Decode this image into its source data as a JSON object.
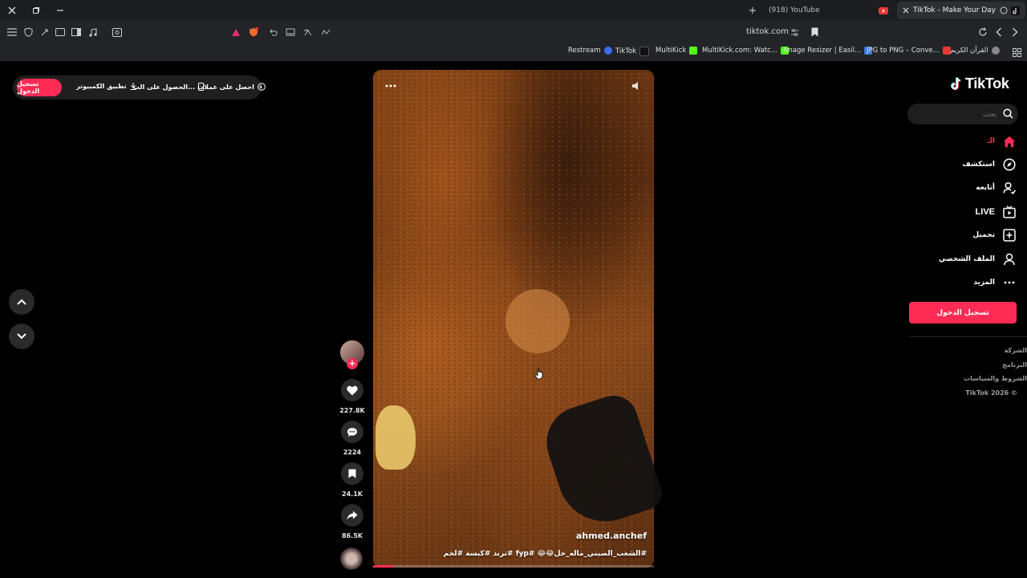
{
  "browser": {
    "tabs": [
      {
        "label": "(918) YouTube",
        "active": false
      },
      {
        "label": "TikTok - Make Your Day",
        "active": true
      }
    ],
    "url": "tiktok.com",
    "bookmarks": [
      {
        "label": "Restream",
        "color": "#3b6cf0"
      },
      {
        "label": "TikTok",
        "color": "#111111"
      },
      {
        "label": "MultiKick",
        "color": "#53fc18"
      },
      {
        "label": "MultiKick.com: Watc...",
        "color": "#53fc18"
      },
      {
        "label": "Image Resizer | Easil...",
        "color": "#3a7bd5"
      },
      {
        "label": "JPG to PNG – Conve...",
        "color": "#e53935"
      },
      {
        "label": "القرآن الكريم",
        "color": "#888888"
      }
    ]
  },
  "top_pill": {
    "login_label": "تسجيل الدخول",
    "desktop_app_label": "تطبيق الكمبيوتر",
    "get_app_label": "الحصول على الت...",
    "coins_label": "احصل على عملات"
  },
  "video": {
    "author": "ahmed.anchef",
    "caption": "#الشعب_الصيني_ماله_حل😂😂 #fyp #ترند #كبسة #لحم",
    "progress": 0.07
  },
  "actions": {
    "likes": "227.8K",
    "comments": "2224",
    "saves": "24.1K",
    "shares": "86.5K"
  },
  "sidebar": {
    "logo_text": "TikTok",
    "search_placeholder": "بحث",
    "nav": [
      {
        "label": "الـ",
        "icon": "home-icon",
        "active": true
      },
      {
        "label": "استكشف",
        "icon": "compass-icon",
        "active": false
      },
      {
        "label": "أتابعه",
        "icon": "following-icon",
        "active": false
      },
      {
        "label": "LIVE",
        "icon": "live-icon",
        "active": false
      },
      {
        "label": "تحميل",
        "icon": "upload-icon",
        "active": false
      },
      {
        "label": "الملف الشخصي",
        "icon": "profile-icon",
        "active": false
      },
      {
        "label": "المزيد",
        "icon": "more-icon",
        "active": false
      }
    ],
    "login_label": "تسجيل الدخول",
    "footer": [
      "الشركة",
      "البرنامج",
      "الشروط والسياسات",
      "TikTok 2026 ©"
    ]
  },
  "colors": {
    "accent": "#fe2c55",
    "background": "#000000",
    "surface": "#2b2b2b"
  }
}
